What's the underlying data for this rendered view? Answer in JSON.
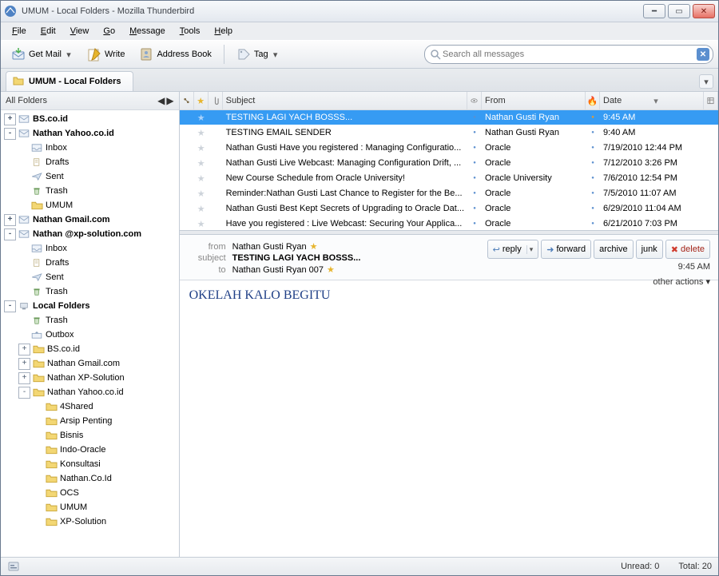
{
  "title": "UMUM - Local Folders - Mozilla Thunderbird",
  "menu": {
    "file": "File",
    "edit": "Edit",
    "view": "View",
    "go": "Go",
    "message": "Message",
    "tools": "Tools",
    "help": "Help"
  },
  "toolbar": {
    "getmail": "Get Mail",
    "write": "Write",
    "abook": "Address Book",
    "tag": "Tag"
  },
  "search": {
    "placeholder": "Search all messages"
  },
  "tab": {
    "label": "UMUM - Local Folders"
  },
  "sidebar": {
    "header": "All Folders"
  },
  "tree": [
    {
      "tw": "+",
      "icon": "mail",
      "label": "BS.co.id",
      "cls": "acct",
      "ind": 0
    },
    {
      "tw": "-",
      "icon": "mail",
      "label": "Nathan Yahoo.co.id",
      "cls": "acct",
      "ind": 0
    },
    {
      "tw": "",
      "icon": "inbox",
      "label": "Inbox",
      "ind": 1
    },
    {
      "tw": "",
      "icon": "drafts",
      "label": "Drafts",
      "ind": 1
    },
    {
      "tw": "",
      "icon": "sent",
      "label": "Sent",
      "ind": 1
    },
    {
      "tw": "",
      "icon": "trash",
      "label": "Trash",
      "ind": 1
    },
    {
      "tw": "",
      "icon": "folder",
      "label": "UMUM",
      "ind": 1
    },
    {
      "tw": "+",
      "icon": "mail",
      "label": "Nathan Gmail.com",
      "cls": "acct",
      "ind": 0
    },
    {
      "tw": "-",
      "icon": "mail",
      "label": "Nathan @xp-solution.com",
      "cls": "acct",
      "ind": 0
    },
    {
      "tw": "",
      "icon": "inbox",
      "label": "Inbox",
      "ind": 1
    },
    {
      "tw": "",
      "icon": "drafts",
      "label": "Drafts",
      "ind": 1
    },
    {
      "tw": "",
      "icon": "sent",
      "label": "Sent",
      "ind": 1
    },
    {
      "tw": "",
      "icon": "trash",
      "label": "Trash",
      "ind": 1
    },
    {
      "tw": "-",
      "icon": "localfolders",
      "label": "Local Folders",
      "cls": "acct",
      "ind": 0
    },
    {
      "tw": "",
      "icon": "trash",
      "label": "Trash",
      "ind": 1
    },
    {
      "tw": "",
      "icon": "outbox",
      "label": "Outbox",
      "ind": 1
    },
    {
      "tw": "+",
      "icon": "folder",
      "label": "BS.co.id",
      "ind": 1
    },
    {
      "tw": "+",
      "icon": "folder",
      "label": "Nathan Gmail.com",
      "ind": 1
    },
    {
      "tw": "+",
      "icon": "folder",
      "label": "Nathan XP-Solution",
      "ind": 1
    },
    {
      "tw": "-",
      "icon": "folder",
      "label": "Nathan Yahoo.co.id",
      "ind": 1
    },
    {
      "tw": "",
      "icon": "folder",
      "label": "4Shared",
      "ind": 2
    },
    {
      "tw": "",
      "icon": "folder",
      "label": "Arsip Penting",
      "ind": 2
    },
    {
      "tw": "",
      "icon": "folder",
      "label": "Bisnis",
      "ind": 2
    },
    {
      "tw": "",
      "icon": "folder",
      "label": "Indo-Oracle",
      "ind": 2
    },
    {
      "tw": "",
      "icon": "folder",
      "label": "Konsultasi",
      "ind": 2
    },
    {
      "tw": "",
      "icon": "folder",
      "label": "Nathan.Co.Id",
      "ind": 2
    },
    {
      "tw": "",
      "icon": "folder",
      "label": "OCS",
      "ind": 2
    },
    {
      "tw": "",
      "icon": "folder",
      "label": "UMUM",
      "ind": 2
    },
    {
      "tw": "",
      "icon": "folder",
      "label": "XP-Solution",
      "ind": 2
    }
  ],
  "columns": {
    "subject": "Subject",
    "from": "From",
    "date": "Date"
  },
  "messages": [
    {
      "subject": "TESTING LAGI YACH BOSSS...",
      "from": "Nathan Gusti Ryan",
      "date": "9:45 AM",
      "fire": "o",
      "sel": true
    },
    {
      "subject": "TESTING EMAIL SENDER",
      "from": "Nathan Gusti Ryan",
      "date": "9:40 AM",
      "fire": "b"
    },
    {
      "subject": "Nathan Gusti Have you registered : Managing Configuratio...",
      "from": "Oracle",
      "date": "7/19/2010 12:44 PM",
      "fire": "b"
    },
    {
      "subject": "Nathan Gusti Live Webcast: Managing Configuration Drift, ...",
      "from": "Oracle",
      "date": "7/12/2010 3:26 PM",
      "fire": "b"
    },
    {
      "subject": "New Course Schedule from Oracle University!",
      "from": "Oracle University",
      "date": "7/6/2010 12:54 PM",
      "fire": "b"
    },
    {
      "subject": "Reminder:Nathan Gusti Last Chance to Register for the Be...",
      "from": "Oracle",
      "date": "7/5/2010 11:07 AM",
      "fire": "b"
    },
    {
      "subject": "Nathan Gusti Best Kept Secrets of Upgrading to Oracle Dat...",
      "from": "Oracle",
      "date": "6/29/2010 11:04 AM",
      "fire": "b"
    },
    {
      "subject": "Have you registered : Live Webcast: Securing Your Applica...",
      "from": "Oracle",
      "date": "6/21/2010 7:03 PM",
      "fire": "b"
    }
  ],
  "header": {
    "from_k": "from",
    "from_v": "Nathan Gusti Ryan",
    "subject_k": "subject",
    "subject_v": "TESTING LAGI YACH BOSSS...",
    "to_k": "to",
    "to_v": "Nathan Gusti Ryan 007",
    "time": "9:45 AM",
    "other": "other actions",
    "reply": "reply",
    "forward": "forward",
    "archive": "archive",
    "junk": "junk",
    "delete": "delete"
  },
  "body": "OKELAH KALO BEGITU",
  "status": {
    "unread_l": "Unread:",
    "unread_v": "0",
    "total_l": "Total:",
    "total_v": "20"
  }
}
